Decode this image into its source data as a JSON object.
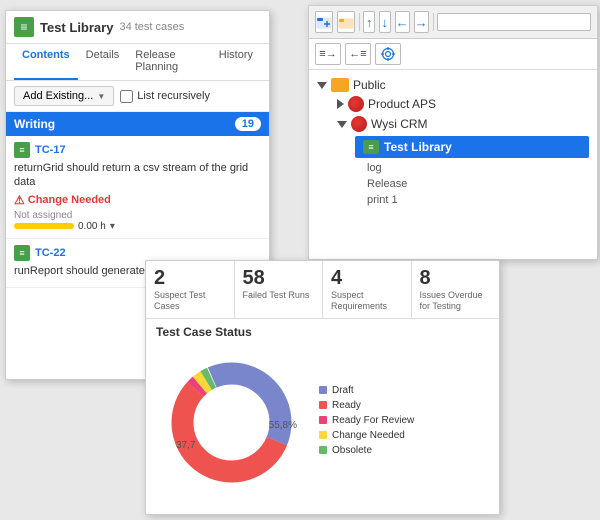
{
  "leftPanel": {
    "headerIcon": "list-icon",
    "title": "Test Library",
    "count": "34 test cases",
    "tabs": [
      "Contents",
      "Details",
      "Release Planning",
      "History"
    ],
    "activeTab": "Contents",
    "addButton": "Add Existing...",
    "checkboxLabel": "List recursively",
    "section": {
      "name": "Writing",
      "badge": "19"
    },
    "testCases": [
      {
        "id": "TC-17",
        "description": "returnGrid should return a csv stream of the grid data",
        "status": "Change Needed",
        "assigned": "Not assigned",
        "time": "0.00 h"
      },
      {
        "id": "TC-22",
        "description": "runReport should generate a user's temp directory"
      }
    ]
  },
  "rightPanel": {
    "toolbarIcons": [
      "folder-add",
      "folder",
      "arrow-up",
      "arrow-down",
      "arrow-left",
      "arrow-right"
    ],
    "searchPlaceholder": "",
    "tree": {
      "public": {
        "label": "Public",
        "children": [
          {
            "label": "Product APS"
          },
          {
            "label": "Wysi CRM",
            "children": [
              {
                "label": "Test Library",
                "selected": true
              },
              {
                "label": "log"
              },
              {
                "label": "Release"
              },
              {
                "label": "print 1"
              }
            ]
          }
        ]
      }
    }
  },
  "bottomPanel": {
    "stats": [
      {
        "number": "2",
        "label": "Suspect Test Cases"
      },
      {
        "number": "58",
        "label": "Failed Test Runs"
      },
      {
        "number": "4",
        "label": "Suspect Requirements"
      },
      {
        "number": "8",
        "label": "Issues Overdue for Testing"
      }
    ],
    "chartTitle": "Test Case Status",
    "chart": {
      "segments": [
        {
          "label": "Draft",
          "color": "#7986cb",
          "percent": 37.7,
          "startAngle": 0,
          "sweepAngle": 135.72
        },
        {
          "label": "Ready",
          "color": "#ef5350",
          "percent": 55.8,
          "startAngle": 135.72,
          "sweepAngle": 200.88
        },
        {
          "label": "Ready For Review",
          "color": "#ec407a",
          "percent": 2.0,
          "startAngle": 336.6,
          "sweepAngle": 7.2
        },
        {
          "label": "Change Needed",
          "color": "#fdd835",
          "percent": 2.5,
          "startAngle": 343.8,
          "sweepAngle": 9.0
        },
        {
          "label": "Obsolete",
          "color": "#66bb6a",
          "percent": 2.0,
          "startAngle": 352.8,
          "sweepAngle": 7.2
        }
      ],
      "pct1": "37,7",
      "pct2": "55,8%"
    }
  }
}
